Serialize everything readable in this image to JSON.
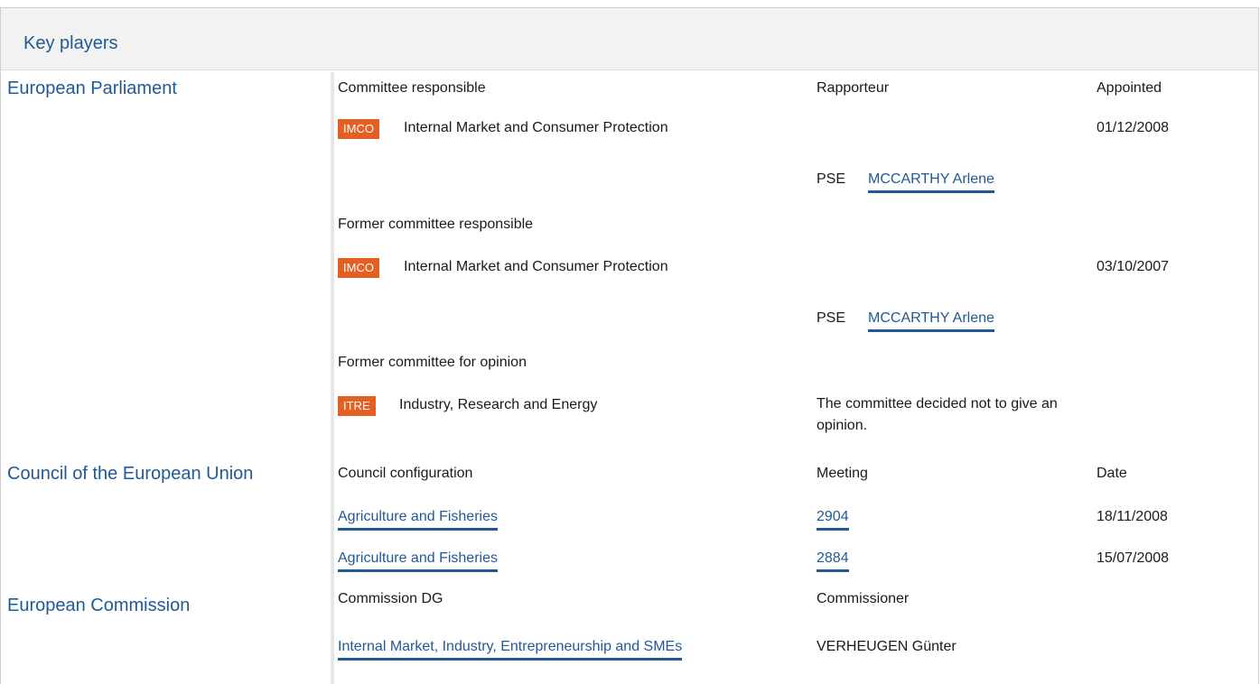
{
  "section": {
    "title": "Key players"
  },
  "parliament": {
    "name": "European Parliament",
    "col_headers": {
      "committee": "Committee responsible",
      "rapporteur": "Rapporteur",
      "appointed": "Appointed"
    },
    "responsible": {
      "badge": "IMCO",
      "committee": "Internal Market and Consumer Protection",
      "date": "01/12/2008",
      "group": "PSE",
      "rapporteur": "MCCARTHY Arlene"
    },
    "former_label": "Former committee responsible",
    "former": {
      "badge": "IMCO",
      "committee": "Internal Market and Consumer Protection",
      "date": "03/10/2007",
      "group": "PSE",
      "rapporteur": "MCCARTHY Arlene"
    },
    "opinion_label": "Former committee for opinion",
    "opinion": {
      "badge": "ITRE",
      "committee": "Industry, Research and Energy",
      "note": "The committee decided not to give an opinion."
    }
  },
  "council": {
    "name": "Council of the European Union",
    "col_headers": {
      "configuration": "Council configuration",
      "meeting": "Meeting",
      "date": "Date"
    },
    "rows": [
      {
        "configuration": "Agriculture and Fisheries",
        "meeting": "2904",
        "date": "18/11/2008"
      },
      {
        "configuration": "Agriculture and Fisheries",
        "meeting": "2884",
        "date": "15/07/2008"
      }
    ]
  },
  "commission": {
    "name": "European Commission",
    "col_headers": {
      "dg": "Commission DG",
      "commissioner": "Commissioner"
    },
    "dg": "Internal Market, Industry, Entrepreneurship and SMEs",
    "commissioner": "VERHEUGEN Günter"
  },
  "colors": {
    "link": "#1f5a96",
    "badge": "#e35f23",
    "header_bg": "#f2f2f2"
  }
}
